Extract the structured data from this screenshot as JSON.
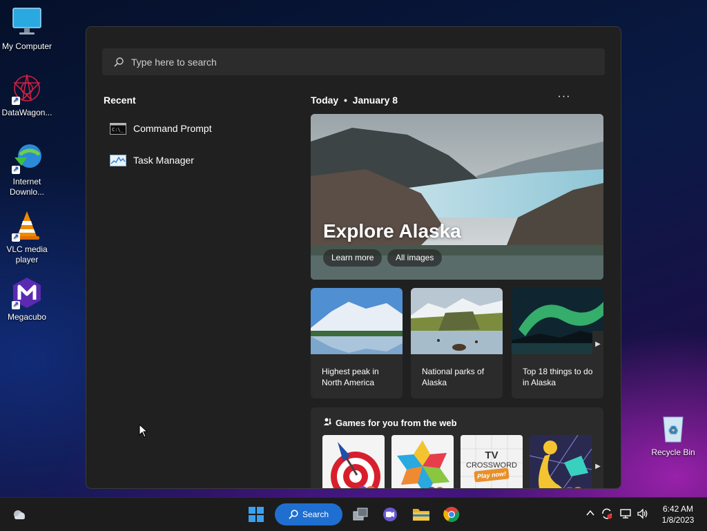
{
  "desktop": {
    "icons": [
      {
        "label": "My Computer"
      },
      {
        "label": "DataWagon..."
      },
      {
        "label": "Internet\nDownlo..."
      },
      {
        "label": "VLC media\nplayer"
      },
      {
        "label": "Megacubo"
      },
      {
        "label": "Recycle Bin"
      }
    ]
  },
  "start": {
    "search_placeholder": "Type here to search",
    "recent_title": "Recent",
    "recent": [
      {
        "label": "Command Prompt",
        "icon": "command-prompt-icon"
      },
      {
        "label": "Task Manager",
        "icon": "task-manager-icon"
      }
    ],
    "today_label": "Today",
    "date_label": "January 8",
    "more_label": "···",
    "hero": {
      "title": "Explore Alaska",
      "learn_more": "Learn more",
      "all_images": "All images"
    },
    "cards": [
      {
        "label": "Highest peak in North America"
      },
      {
        "label": "National parks of Alaska"
      },
      {
        "label": "Top 18 things to do in Alaska"
      }
    ],
    "games_title": "Games for you from the web",
    "games": [
      {
        "name": "darts-game-tile"
      },
      {
        "name": "colorful-puzzle-game-tile"
      },
      {
        "name": "tv-crossword-game-tile",
        "line1": "TV",
        "line2": "CROSSWORD",
        "line3": "Play now!"
      },
      {
        "name": "runner-game-tile"
      }
    ]
  },
  "taskbar": {
    "search_label": "Search",
    "time": "6:42 AM",
    "date": "1/8/2023"
  },
  "colors": {
    "accent": "#1e6fd0",
    "panel": "#202020",
    "card": "#2b2b2b"
  }
}
